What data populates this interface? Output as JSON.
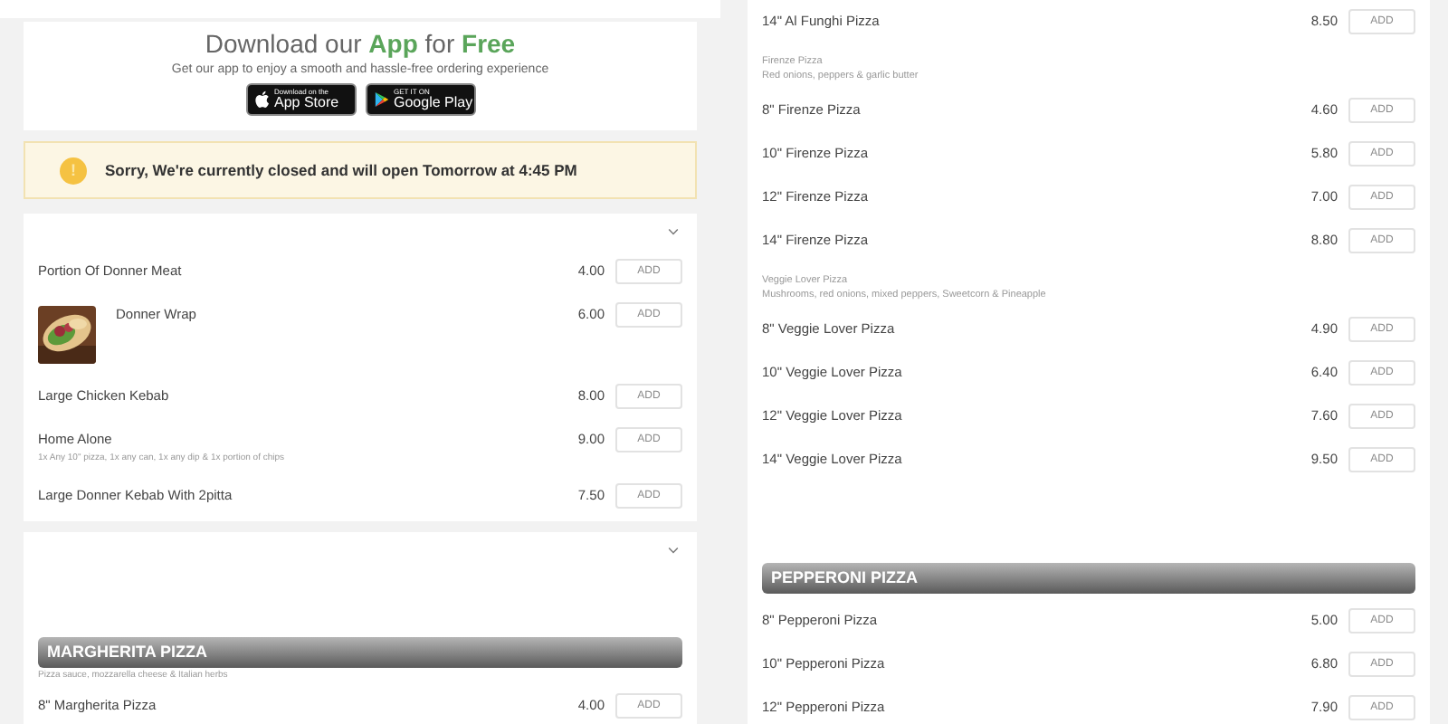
{
  "app_banner": {
    "title": "Download our **App** for **Free**",
    "subtitle": "Get our app to enjoy a smooth and hassle-free ordering experience",
    "badges": [
      {
        "kind": "apple",
        "small": "Download on the",
        "big": "App Store"
      },
      {
        "kind": "google",
        "small": "GET IT ON",
        "big": "Google Play"
      }
    ]
  },
  "notice": {
    "icon": "!",
    "text": "Sorry, We're currently closed and will open Tomorrow at 4:45 PM"
  },
  "left_sections": [
    {
      "blocks": [
        {
          "kind": "item",
          "name": "Portion Of Donner Meat",
          "price": "4.00",
          "button": "ADD",
          "disabled": true
        },
        {
          "kind": "item",
          "name": "Donner Wrap",
          "price": "6.00",
          "button": "ADD",
          "disabled": true
        },
        {
          "kind": "item",
          "name": "Large Chicken Kebab",
          "price": "8.00",
          "button": "ADD",
          "disabled": true
        },
        {
          "kind": "item",
          "name": "Home Alone",
          "description": "1x Any 10\" pizza, 1x any can, 1x any dip & 1x portion of chips",
          "price": "9.00",
          "button": "ADD",
          "disabled": true
        },
        {
          "kind": "item",
          "name": "Large Donner Kebab With 2pitta",
          "price": "7.50",
          "button": "ADD",
          "disabled": true
        }
      ]
    },
    {
      "blocks": [
        {
          "kind": "banner",
          "title": "MARGHERITA PIZZA",
          "description": "Pizza sauce, mozzarella cheese & Italian herbs"
        },
        {
          "kind": "item",
          "name": "8\" Margherita Pizza",
          "price": "4.00",
          "button": "ADD",
          "disabled": true
        }
      ]
    }
  ],
  "right_blocks": [
    {
      "kind": "item",
      "name": "14\" Al Funghi Pizza",
      "price": "8.50",
      "button": "ADD",
      "disabled": true
    },
    {
      "kind": "subheading",
      "title": "Firenze Pizza",
      "description": "Red onions, peppers & garlic butter"
    },
    {
      "kind": "item",
      "name": "8\" Firenze Pizza",
      "price": "4.60",
      "button": "ADD",
      "disabled": true
    },
    {
      "kind": "item",
      "name": "10\" Firenze Pizza",
      "price": "5.80",
      "button": "ADD",
      "disabled": true
    },
    {
      "kind": "item",
      "name": "12\" Firenze Pizza",
      "price": "7.00",
      "button": "ADD",
      "disabled": true
    },
    {
      "kind": "item",
      "name": "14\" Firenze Pizza",
      "price": "8.80",
      "button": "ADD",
      "disabled": true
    },
    {
      "kind": "subheading",
      "title": "Veggie Lover Pizza",
      "description": "Mushrooms, red onions, mixed peppers, Sweetcorn & Pineapple"
    },
    {
      "kind": "item",
      "name": "8\" Veggie Lover Pizza",
      "price": "4.90",
      "button": "ADD",
      "disabled": true
    },
    {
      "kind": "item",
      "name": "10\" Veggie Lover Pizza",
      "price": "6.40",
      "button": "ADD",
      "disabled": true
    },
    {
      "kind": "item",
      "name": "12\" Veggie Lover Pizza",
      "price": "7.60",
      "button": "ADD",
      "disabled": true
    },
    {
      "kind": "item",
      "name": "14\" Veggie Lover Pizza",
      "price": "9.50",
      "button": "ADD",
      "disabled": true
    },
    {
      "kind": "banner",
      "title": "PEPPERONI PIZZA"
    },
    {
      "kind": "item",
      "name": "8\" Pepperoni Pizza",
      "price": "5.00",
      "button": "ADD",
      "disabled": true
    },
    {
      "kind": "item",
      "name": "10\" Pepperoni Pizza",
      "price": "6.80",
      "button": "ADD",
      "disabled": true
    },
    {
      "kind": "item",
      "name": "12\" Pepperoni Pizza",
      "price": "7.90",
      "button": "ADD",
      "disabled": true
    }
  ]
}
